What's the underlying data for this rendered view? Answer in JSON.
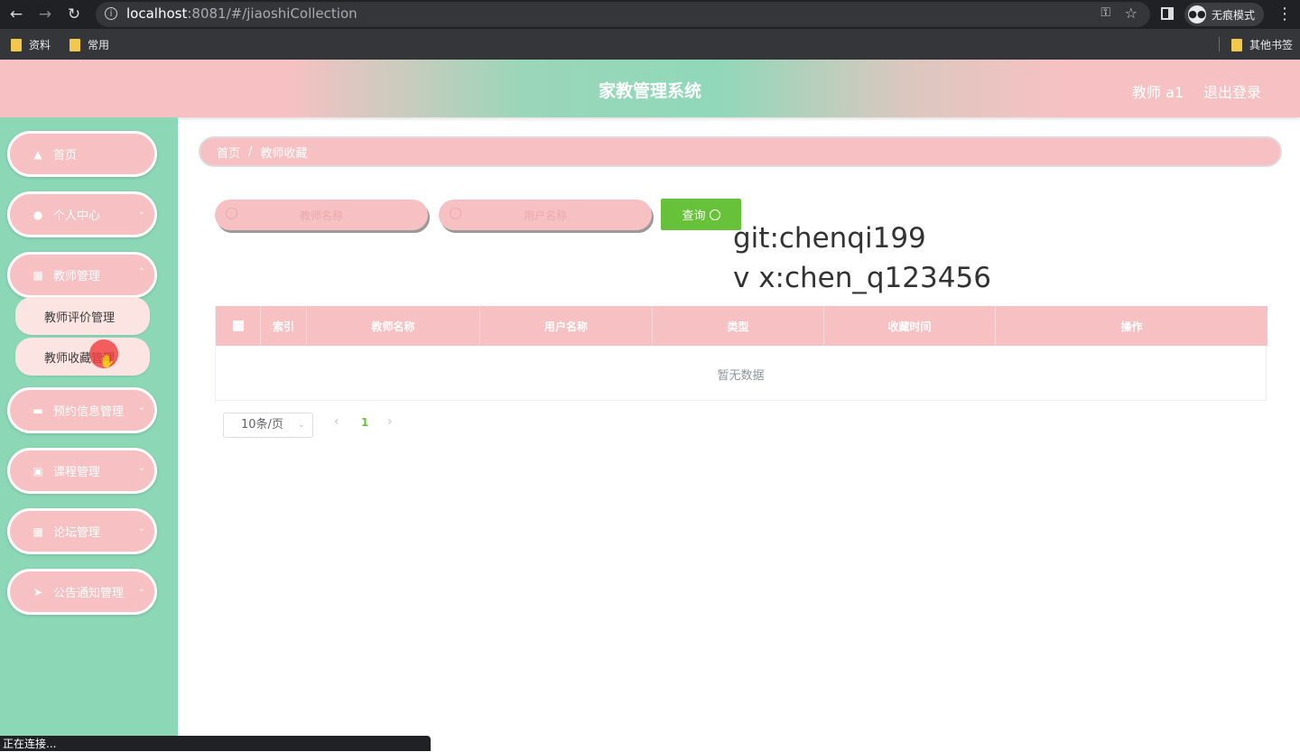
{
  "browser": {
    "url_host": "localhost",
    "url_rest": ":8081/#/jiaoshiCollection",
    "incognito_label": "无痕模式",
    "bookmarks": [
      "资料",
      "常用"
    ],
    "other_bookmarks": "其他书签",
    "status_text": "正在连接..."
  },
  "header": {
    "title": "家教管理系统",
    "user": "教师 a1",
    "logout": "退出登录"
  },
  "sidebar": {
    "items": [
      {
        "label": "首页",
        "icon": "home-icon"
      },
      {
        "label": "个人中心",
        "icon": "user-icon"
      },
      {
        "label": "教师管理",
        "icon": "document-icon"
      },
      {
        "label": "预约信息管理",
        "icon": "ticket-icon"
      },
      {
        "label": "课程管理",
        "icon": "briefcase-icon"
      },
      {
        "label": "论坛管理",
        "icon": "grid-icon"
      },
      {
        "label": "公告通知管理",
        "icon": "send-icon"
      }
    ],
    "sub_items": [
      "教师评价管理",
      "教师收藏管理"
    ]
  },
  "breadcrumb": [
    "首页",
    "教师收藏"
  ],
  "search": {
    "teacher_name_placeholder": "教师名称",
    "user_name_placeholder": "用户名称",
    "query_label": "查询"
  },
  "watermark": [
    "git:chenqi199",
    "v x:chen_q123456"
  ],
  "table": {
    "columns": [
      "",
      "索引",
      "教师名称",
      "用户名称",
      "类型",
      "收藏时间",
      "操作"
    ],
    "rows": [],
    "empty_text": "暂无数据"
  },
  "pagination": {
    "page_size": "10条/页",
    "current_page": "1"
  },
  "colors": {
    "pink": "#f7c1c3",
    "mint": "#8bd7b6",
    "green_button": "#67c23a"
  }
}
